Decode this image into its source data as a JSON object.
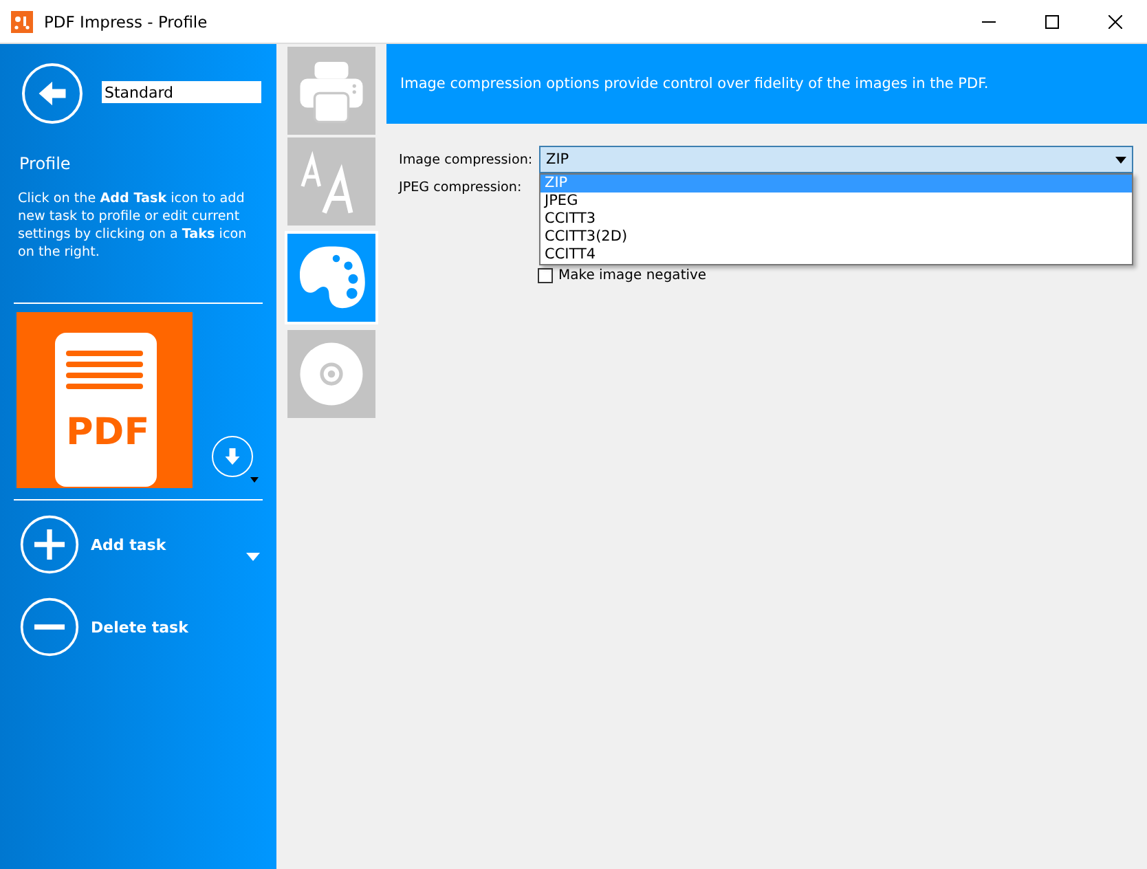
{
  "window": {
    "title": "PDF Impress - Profile"
  },
  "sidebar": {
    "profile_name": "Standard",
    "heading": "Profile",
    "file_badge": "PDF",
    "help": "Click on the **Add Task** icon to add new task to profile or edit current settings by clicking on a **Taks** icon on the right.",
    "actions": [
      {
        "kind": "add",
        "label": "Add task"
      },
      {
        "kind": "delete",
        "label": "Delete task"
      }
    ]
  },
  "tasks": [
    {
      "kind": "printer",
      "selected": false
    },
    {
      "kind": "font",
      "selected": false
    },
    {
      "kind": "palette",
      "selected": true
    },
    {
      "kind": "disc",
      "selected": false
    }
  ],
  "header": {
    "text": "Image compression options provide control over fidelity of the images in the PDF."
  },
  "form": {
    "image_compression": {
      "label": "Image compression:",
      "value": "ZIP",
      "expanded": true,
      "options": [
        {
          "label": "ZIP",
          "selected": true
        },
        {
          "label": "JPEG",
          "selected": false
        },
        {
          "label": "CCITT3",
          "selected": false
        },
        {
          "label": "CCITT3(2D)",
          "selected": false
        },
        {
          "label": "CCITT4",
          "selected": false
        }
      ]
    },
    "jpeg_compression": {
      "label": "JPEG compression:"
    },
    "negative": {
      "label": "Make image negative",
      "checked": false
    }
  }
}
